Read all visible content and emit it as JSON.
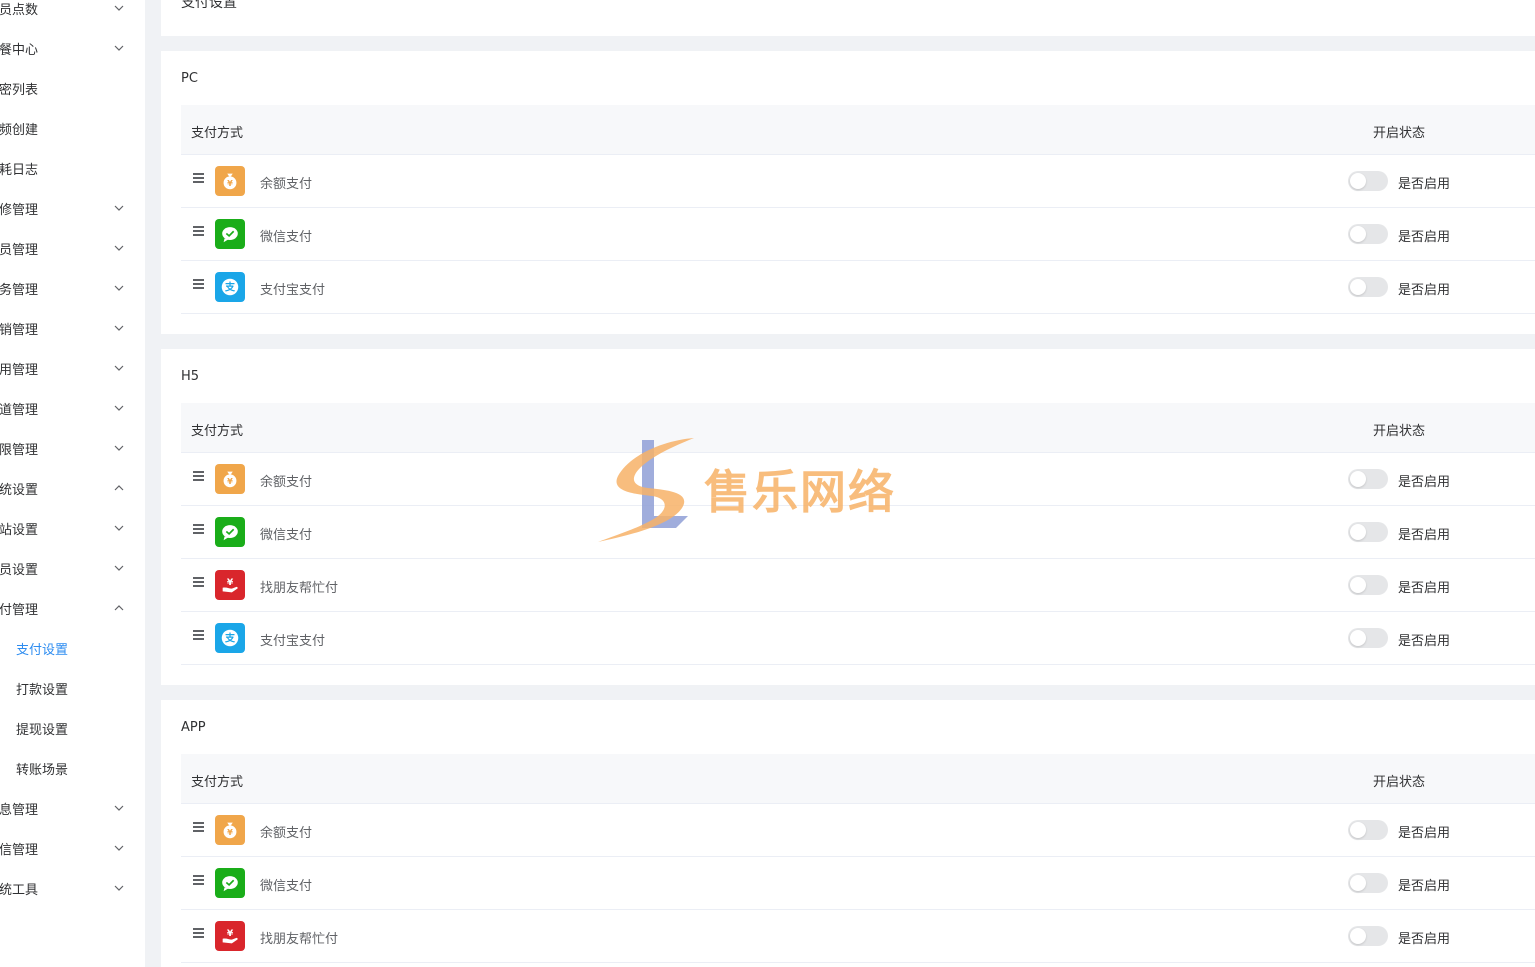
{
  "sidebar": {
    "items": [
      {
        "label": "会员点数",
        "chevron": "down"
      },
      {
        "label": "套餐中心",
        "chevron": "down"
      },
      {
        "label": "卡密列表",
        "chevron": ""
      },
      {
        "label": "视频创建",
        "chevron": ""
      },
      {
        "label": "消耗日志",
        "chevron": ""
      },
      {
        "label": "装修管理",
        "chevron": "down"
      },
      {
        "label": "会员管理",
        "chevron": "down"
      },
      {
        "label": "财务管理",
        "chevron": "down"
      },
      {
        "label": "营销管理",
        "chevron": "down"
      },
      {
        "label": "应用管理",
        "chevron": "down"
      },
      {
        "label": "渠道管理",
        "chevron": "down"
      },
      {
        "label": "权限管理",
        "chevron": "down"
      },
      {
        "label": "系统设置",
        "chevron": "up"
      },
      {
        "label": "网站设置",
        "chevron": "down"
      },
      {
        "label": "会员设置",
        "chevron": "down"
      },
      {
        "label": "支付管理",
        "chevron": "up"
      },
      {
        "label": "支付设置",
        "chevron": "",
        "sub": true,
        "active": true
      },
      {
        "label": "打款设置",
        "chevron": "",
        "sub": true
      },
      {
        "label": "提现设置",
        "chevron": "",
        "sub": true
      },
      {
        "label": "转账场景",
        "chevron": "",
        "sub": true
      },
      {
        "label": "消息管理",
        "chevron": "down"
      },
      {
        "label": "短信管理",
        "chevron": "down"
      },
      {
        "label": "系统工具",
        "chevron": "down"
      }
    ]
  },
  "page": {
    "title": "支付设置"
  },
  "table_header": {
    "method": "支付方式",
    "status": "开启状态"
  },
  "switch_label": "是否启用",
  "sections": [
    {
      "title": "PC",
      "rows": [
        {
          "name": "余额支付",
          "icon": "balance"
        },
        {
          "name": "微信支付",
          "icon": "wechat"
        },
        {
          "name": "支付宝支付",
          "icon": "alipay"
        }
      ]
    },
    {
      "title": "H5",
      "rows": [
        {
          "name": "余额支付",
          "icon": "balance"
        },
        {
          "name": "微信支付",
          "icon": "wechat"
        },
        {
          "name": "找朋友帮忙付",
          "icon": "friend"
        },
        {
          "name": "支付宝支付",
          "icon": "alipay"
        }
      ]
    },
    {
      "title": "APP",
      "rows": [
        {
          "name": "余额支付",
          "icon": "balance"
        },
        {
          "name": "微信支付",
          "icon": "wechat"
        },
        {
          "name": "找朋友帮忙付",
          "icon": "friend"
        }
      ]
    }
  ],
  "watermark": {
    "text": "售乐网络"
  },
  "colors": {
    "active": "#2d8cf0",
    "balance": "#f0a64a",
    "wechat": "#1aad19",
    "friend": "#d9262c",
    "alipay": "#1aa6e8"
  }
}
